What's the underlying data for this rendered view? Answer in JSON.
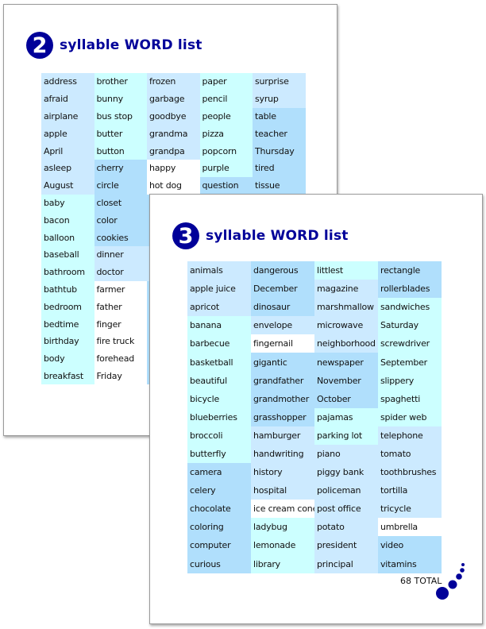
{
  "colors": {
    "accent": "#000099",
    "cyan": "#ccffff",
    "pale_blue": "#cceaff",
    "medium_blue": "#b0dffc",
    "white": "#ffffff"
  },
  "page1": {
    "number": "2",
    "title": "syllable WORD list",
    "columns": [
      [
        {
          "w": "address",
          "c": "pale"
        },
        {
          "w": "afraid",
          "c": "pale"
        },
        {
          "w": "airplane",
          "c": "pale"
        },
        {
          "w": "apple",
          "c": "pale"
        },
        {
          "w": "April",
          "c": "pale"
        },
        {
          "w": "asleep",
          "c": "pale"
        },
        {
          "w": "August",
          "c": "pale"
        },
        {
          "w": "baby",
          "c": "cyan"
        },
        {
          "w": "bacon",
          "c": "cyan"
        },
        {
          "w": "balloon",
          "c": "cyan"
        },
        {
          "w": "baseball",
          "c": "cyan"
        },
        {
          "w": "bathroom",
          "c": "cyan"
        },
        {
          "w": "bathtub",
          "c": "cyan"
        },
        {
          "w": "bedroom",
          "c": "cyan"
        },
        {
          "w": "bedtime",
          "c": "cyan"
        },
        {
          "w": "birthday",
          "c": "cyan"
        },
        {
          "w": "body",
          "c": "cyan"
        },
        {
          "w": "breakfast",
          "c": "cyan"
        }
      ],
      [
        {
          "w": "brother",
          "c": "cyan"
        },
        {
          "w": "bunny",
          "c": "cyan"
        },
        {
          "w": "bus stop",
          "c": "cyan"
        },
        {
          "w": "butter",
          "c": "cyan"
        },
        {
          "w": "button",
          "c": "cyan"
        },
        {
          "w": "cherry",
          "c": "med"
        },
        {
          "w": "circle",
          "c": "med"
        },
        {
          "w": "closet",
          "c": "med"
        },
        {
          "w": "color",
          "c": "med"
        },
        {
          "w": "cookies",
          "c": "med"
        },
        {
          "w": "dinner",
          "c": "pale"
        },
        {
          "w": "doctor",
          "c": "pale"
        },
        {
          "w": "farmer",
          "c": "white"
        },
        {
          "w": "father",
          "c": "white"
        },
        {
          "w": "finger",
          "c": "white"
        },
        {
          "w": "fire truck",
          "c": "white"
        },
        {
          "w": "forehead",
          "c": "white"
        },
        {
          "w": "Friday",
          "c": "white"
        }
      ],
      [
        {
          "w": "frozen",
          "c": "pale"
        },
        {
          "w": "garbage",
          "c": "pale"
        },
        {
          "w": "goodbye",
          "c": "pale"
        },
        {
          "w": "grandma",
          "c": "pale"
        },
        {
          "w": "grandpa",
          "c": "pale"
        },
        {
          "w": "happy",
          "c": "white"
        },
        {
          "w": "hot dog",
          "c": "white"
        },
        {
          "w": "",
          "c": "med"
        },
        {
          "w": "",
          "c": "med"
        },
        {
          "w": "",
          "c": "med"
        },
        {
          "w": "",
          "c": "pale"
        },
        {
          "w": "",
          "c": "pale"
        },
        {
          "w": "",
          "c": "med"
        },
        {
          "w": "",
          "c": "med"
        },
        {
          "w": "",
          "c": "med"
        },
        {
          "w": "",
          "c": "med"
        },
        {
          "w": "",
          "c": "med"
        },
        {
          "w": "",
          "c": "med"
        }
      ],
      [
        {
          "w": "paper",
          "c": "cyan"
        },
        {
          "w": "pencil",
          "c": "cyan"
        },
        {
          "w": "people",
          "c": "cyan"
        },
        {
          "w": "pizza",
          "c": "cyan"
        },
        {
          "w": "popcorn",
          "c": "cyan"
        },
        {
          "w": "purple",
          "c": "cyan"
        },
        {
          "w": "question",
          "c": "med"
        }
      ],
      [
        {
          "w": "surprise",
          "c": "pale"
        },
        {
          "w": "syrup",
          "c": "pale"
        },
        {
          "w": "table",
          "c": "med"
        },
        {
          "w": "teacher",
          "c": "med"
        },
        {
          "w": "Thursday",
          "c": "med"
        },
        {
          "w": "tired",
          "c": "med"
        },
        {
          "w": "tissue",
          "c": "med"
        }
      ]
    ]
  },
  "page2": {
    "number": "3",
    "title": "syllable WORD list",
    "total": "68 TOTAL",
    "columns": [
      [
        {
          "w": "animals",
          "c": "pale"
        },
        {
          "w": "apple juice",
          "c": "pale"
        },
        {
          "w": "apricot",
          "c": "pale"
        },
        {
          "w": "banana",
          "c": "cyan"
        },
        {
          "w": "barbecue",
          "c": "cyan"
        },
        {
          "w": "basketball",
          "c": "cyan"
        },
        {
          "w": "beautiful",
          "c": "cyan"
        },
        {
          "w": "bicycle",
          "c": "cyan"
        },
        {
          "w": "blueberries",
          "c": "cyan"
        },
        {
          "w": "broccoli",
          "c": "cyan"
        },
        {
          "w": "butterfly",
          "c": "cyan"
        },
        {
          "w": "camera",
          "c": "med"
        },
        {
          "w": "celery",
          "c": "med"
        },
        {
          "w": "chocolate",
          "c": "med"
        },
        {
          "w": "coloring",
          "c": "med"
        },
        {
          "w": "computer",
          "c": "med"
        },
        {
          "w": "curious",
          "c": "med"
        }
      ],
      [
        {
          "w": "dangerous",
          "c": "med"
        },
        {
          "w": "December",
          "c": "med"
        },
        {
          "w": "dinosaur",
          "c": "med"
        },
        {
          "w": "envelope",
          "c": "pale"
        },
        {
          "w": "fingernail",
          "c": "white"
        },
        {
          "w": "gigantic",
          "c": "med"
        },
        {
          "w": "grandfather",
          "c": "med"
        },
        {
          "w": "grandmother",
          "c": "med"
        },
        {
          "w": "grasshopper",
          "c": "med"
        },
        {
          "w": "hamburger",
          "c": "pale"
        },
        {
          "w": "handwriting",
          "c": "pale"
        },
        {
          "w": "history",
          "c": "pale"
        },
        {
          "w": "hospital",
          "c": "pale"
        },
        {
          "w": "ice cream cone",
          "c": "white"
        },
        {
          "w": "ladybug",
          "c": "cyan"
        },
        {
          "w": "lemonade",
          "c": "cyan"
        },
        {
          "w": "library",
          "c": "cyan"
        }
      ],
      [
        {
          "w": "littlest",
          "c": "cyan"
        },
        {
          "w": "magazine",
          "c": "pale"
        },
        {
          "w": "marshmallow",
          "c": "pale"
        },
        {
          "w": "microwave",
          "c": "pale"
        },
        {
          "w": "neighborhood",
          "c": "pale"
        },
        {
          "w": "newspaper",
          "c": "med"
        },
        {
          "w": "November",
          "c": "med"
        },
        {
          "w": "October",
          "c": "med"
        },
        {
          "w": "pajamas",
          "c": "cyan"
        },
        {
          "w": "parking lot",
          "c": "cyan"
        },
        {
          "w": "piano",
          "c": "pale"
        },
        {
          "w": "piggy bank",
          "c": "pale"
        },
        {
          "w": "policeman",
          "c": "pale"
        },
        {
          "w": "post office",
          "c": "pale"
        },
        {
          "w": "potato",
          "c": "pale"
        },
        {
          "w": "president",
          "c": "pale"
        },
        {
          "w": "principal",
          "c": "pale"
        }
      ],
      [
        {
          "w": "rectangle",
          "c": "med"
        },
        {
          "w": "rollerblades",
          "c": "med"
        },
        {
          "w": "sandwiches",
          "c": "cyan"
        },
        {
          "w": "Saturday",
          "c": "cyan"
        },
        {
          "w": "screwdriver",
          "c": "cyan"
        },
        {
          "w": "September",
          "c": "cyan"
        },
        {
          "w": "slippery",
          "c": "cyan"
        },
        {
          "w": "spaghetti",
          "c": "cyan"
        },
        {
          "w": "spider web",
          "c": "cyan"
        },
        {
          "w": "telephone",
          "c": "pale"
        },
        {
          "w": "tomato",
          "c": "pale"
        },
        {
          "w": "toothbrushes",
          "c": "pale"
        },
        {
          "w": "tortilla",
          "c": "pale"
        },
        {
          "w": "tricycle",
          "c": "pale"
        },
        {
          "w": "umbrella",
          "c": "white"
        },
        {
          "w": "video",
          "c": "med"
        },
        {
          "w": "vitamins",
          "c": "med"
        }
      ]
    ]
  }
}
